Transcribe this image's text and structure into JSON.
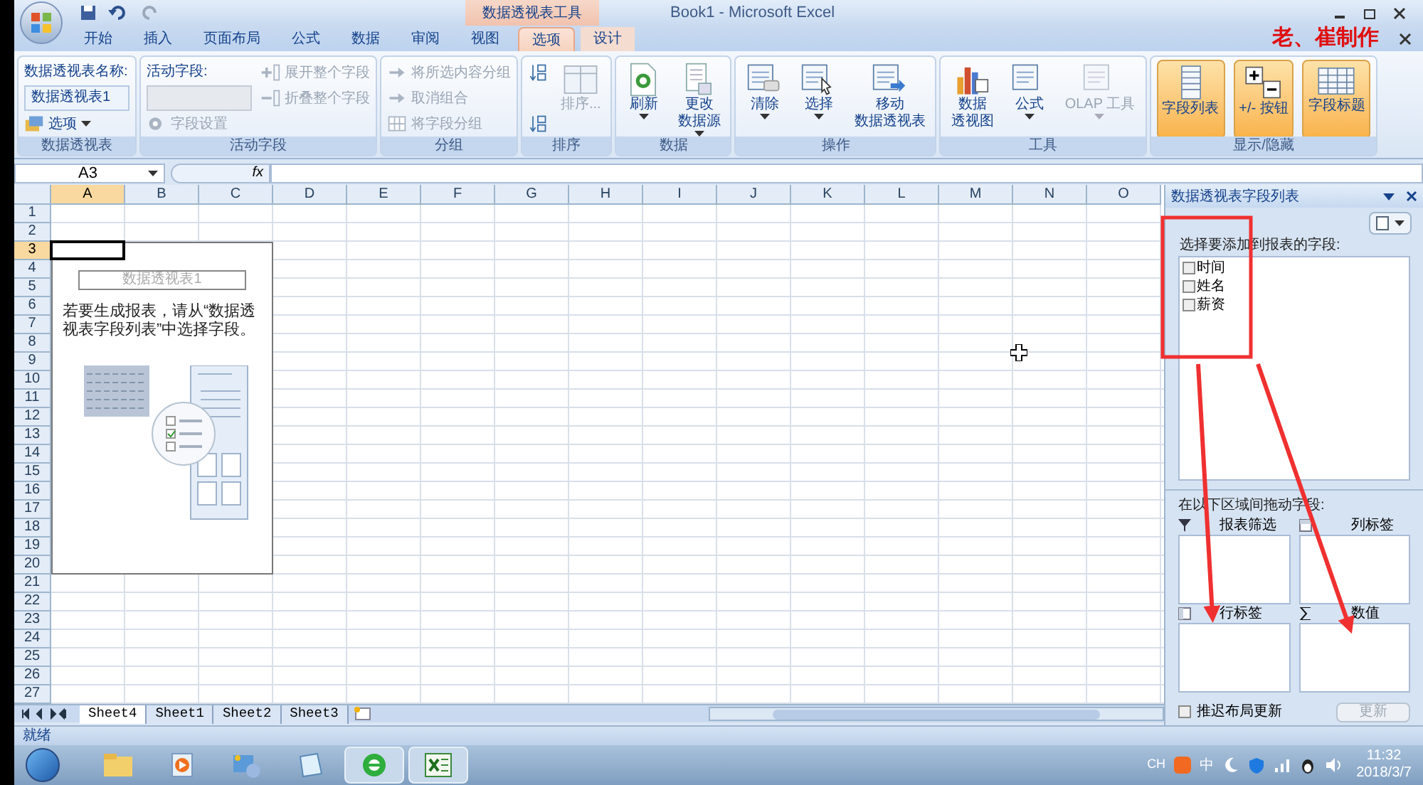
{
  "window": {
    "title": "Book1 - Microsoft Excel",
    "context_group": "数据透视表工具",
    "author_note": "老、崔制作"
  },
  "tabs": [
    {
      "label": "开始",
      "selected": false
    },
    {
      "label": "插入",
      "selected": false
    },
    {
      "label": "页面布局",
      "selected": false
    },
    {
      "label": "公式",
      "selected": false
    },
    {
      "label": "数据",
      "selected": false
    },
    {
      "label": "审阅",
      "selected": false
    },
    {
      "label": "视图",
      "selected": false
    },
    {
      "label": "选项",
      "selected": true,
      "context": true
    },
    {
      "label": "设计",
      "selected": false,
      "context": true
    }
  ],
  "ribbon": [
    {
      "name": "数据透视表",
      "items": [
        {
          "kind": "label",
          "label": "数据透视表名称:"
        },
        {
          "kind": "field",
          "value": "数据透视表1"
        },
        {
          "kind": "small",
          "label": "选项",
          "dropdown": true,
          "disabled": false
        }
      ]
    },
    {
      "name": "活动字段",
      "items": [
        {
          "kind": "label",
          "label": "活动字段:"
        },
        {
          "kind": "field",
          "disabled": true
        },
        {
          "kind": "small",
          "label": "字段设置",
          "disabled": true
        },
        {
          "kind": "small",
          "label": "展开整个字段",
          "disabled": true
        },
        {
          "kind": "small",
          "label": "折叠整个字段",
          "disabled": true
        }
      ]
    },
    {
      "name": "分组",
      "items": [
        {
          "kind": "small",
          "label": "将所选内容分组",
          "disabled": true
        },
        {
          "kind": "small",
          "label": "取消组合",
          "disabled": true
        },
        {
          "kind": "small",
          "label": "将字段分组",
          "disabled": true
        }
      ]
    },
    {
      "name": "排序",
      "items": [
        {
          "kind": "small",
          "disabled": false
        },
        {
          "kind": "spacer"
        },
        {
          "kind": "small",
          "disabled": false
        },
        {
          "kind": "large",
          "lines": [
            "排序..."
          ],
          "disabled": true
        }
      ]
    },
    {
      "name": "数据",
      "items": [
        {
          "kind": "large",
          "lines": [
            "刷新"
          ],
          "dropdown": true,
          "disabled": false
        },
        {
          "kind": "large",
          "lines": [
            "更改",
            "数据源"
          ],
          "dropdown": true,
          "disabled": false
        }
      ]
    },
    {
      "name": "操作",
      "items": [
        {
          "kind": "large",
          "lines": [
            "清除"
          ],
          "dropdown": true,
          "disabled": false
        },
        {
          "kind": "large",
          "lines": [
            "选择"
          ],
          "dropdown": true,
          "disabled": false
        },
        {
          "kind": "large",
          "lines": [
            "移动",
            "数据透视表"
          ],
          "disabled": false
        }
      ]
    },
    {
      "name": "工具",
      "items": [
        {
          "kind": "large",
          "lines": [
            "数据",
            "透视图"
          ],
          "disabled": false
        },
        {
          "kind": "large",
          "lines": [
            "公式"
          ],
          "dropdown": true,
          "disabled": false
        },
        {
          "kind": "large",
          "lines": [
            "OLAP 工具"
          ],
          "dropdown": true,
          "disabled": true
        }
      ]
    },
    {
      "name": "显示/隐藏",
      "items": [
        {
          "kind": "toggle",
          "lines": [
            "字段列表"
          ],
          "on": true
        },
        {
          "kind": "toggle",
          "lines": [
            "+/- 按钮"
          ],
          "on": true
        },
        {
          "kind": "toggle",
          "lines": [
            "字段标题"
          ],
          "on": true
        }
      ]
    }
  ],
  "formula_bar": {
    "name_box": "A3",
    "fx": "fx"
  },
  "columns": [
    {
      "label": "A",
      "selected": true
    },
    {
      "label": "B",
      "selected": false
    },
    {
      "label": "C",
      "selected": false
    },
    {
      "label": "D",
      "selected": false
    },
    {
      "label": "E",
      "selected": false
    },
    {
      "label": "F",
      "selected": false
    },
    {
      "label": "G",
      "selected": false
    },
    {
      "label": "H",
      "selected": false
    },
    {
      "label": "I",
      "selected": false
    },
    {
      "label": "J",
      "selected": false
    },
    {
      "label": "K",
      "selected": false
    },
    {
      "label": "L",
      "selected": false
    },
    {
      "label": "M",
      "selected": false
    },
    {
      "label": "N",
      "selected": false
    },
    {
      "label": "O",
      "selected": false
    }
  ],
  "rows": [
    {
      "label": "1",
      "selected": false
    },
    {
      "label": "2",
      "selected": false
    },
    {
      "label": "3",
      "selected": true
    },
    {
      "label": "4",
      "selected": false
    },
    {
      "label": "5",
      "selected": false
    },
    {
      "label": "6",
      "selected": false
    },
    {
      "label": "7",
      "selected": false
    },
    {
      "label": "8",
      "selected": false
    },
    {
      "label": "9",
      "selected": false
    },
    {
      "label": "10",
      "selected": false
    },
    {
      "label": "11",
      "selected": false
    },
    {
      "label": "12",
      "selected": false
    },
    {
      "label": "13",
      "selected": false
    },
    {
      "label": "14",
      "selected": false
    },
    {
      "label": "15",
      "selected": false
    },
    {
      "label": "16",
      "selected": false
    },
    {
      "label": "17",
      "selected": false
    },
    {
      "label": "18",
      "selected": false
    },
    {
      "label": "19",
      "selected": false
    },
    {
      "label": "20",
      "selected": false
    },
    {
      "label": "21",
      "selected": false
    },
    {
      "label": "22",
      "selected": false
    },
    {
      "label": "23",
      "selected": false
    },
    {
      "label": "24",
      "selected": false
    },
    {
      "label": "25",
      "selected": false
    },
    {
      "label": "26",
      "selected": false
    },
    {
      "label": "27",
      "selected": false
    }
  ],
  "pivot_placeholder": {
    "title": "数据透视表1",
    "message": "若要生成报表，请从“数据透视表字段列表”中选择字段。"
  },
  "sheet_tabs": [
    {
      "label": "Sheet4",
      "selected": true
    },
    {
      "label": "Sheet1",
      "selected": false
    },
    {
      "label": "Sheet2",
      "selected": false
    },
    {
      "label": "Sheet3",
      "selected": false
    }
  ],
  "status_bar": {
    "text": "就绪"
  },
  "field_list": {
    "title": "数据透视表字段列表",
    "prompt": "选择要添加到报表的字段:",
    "fields": [
      {
        "label": "时间",
        "checked": false
      },
      {
        "label": "姓名",
        "checked": false
      },
      {
        "label": "薪资",
        "checked": false
      }
    ],
    "areas_prompt": "在以下区域间拖动字段:",
    "areas": [
      {
        "label": "报表筛选"
      },
      {
        "label": "列标签"
      },
      {
        "label": "行标签"
      },
      {
        "label": "数值"
      }
    ],
    "defer": {
      "label": "推迟布局更新",
      "checked": false
    },
    "update_button": {
      "label": "更新",
      "disabled": true
    }
  },
  "taskbar": {
    "apps": [
      {
        "selected": false
      },
      {
        "selected": false
      },
      {
        "selected": false
      },
      {
        "selected": false
      },
      {
        "selected": true
      },
      {
        "selected": true
      }
    ],
    "tray": {
      "language": "CH",
      "ime": "中",
      "time": "11:32",
      "date": "2018/3/7"
    }
  }
}
